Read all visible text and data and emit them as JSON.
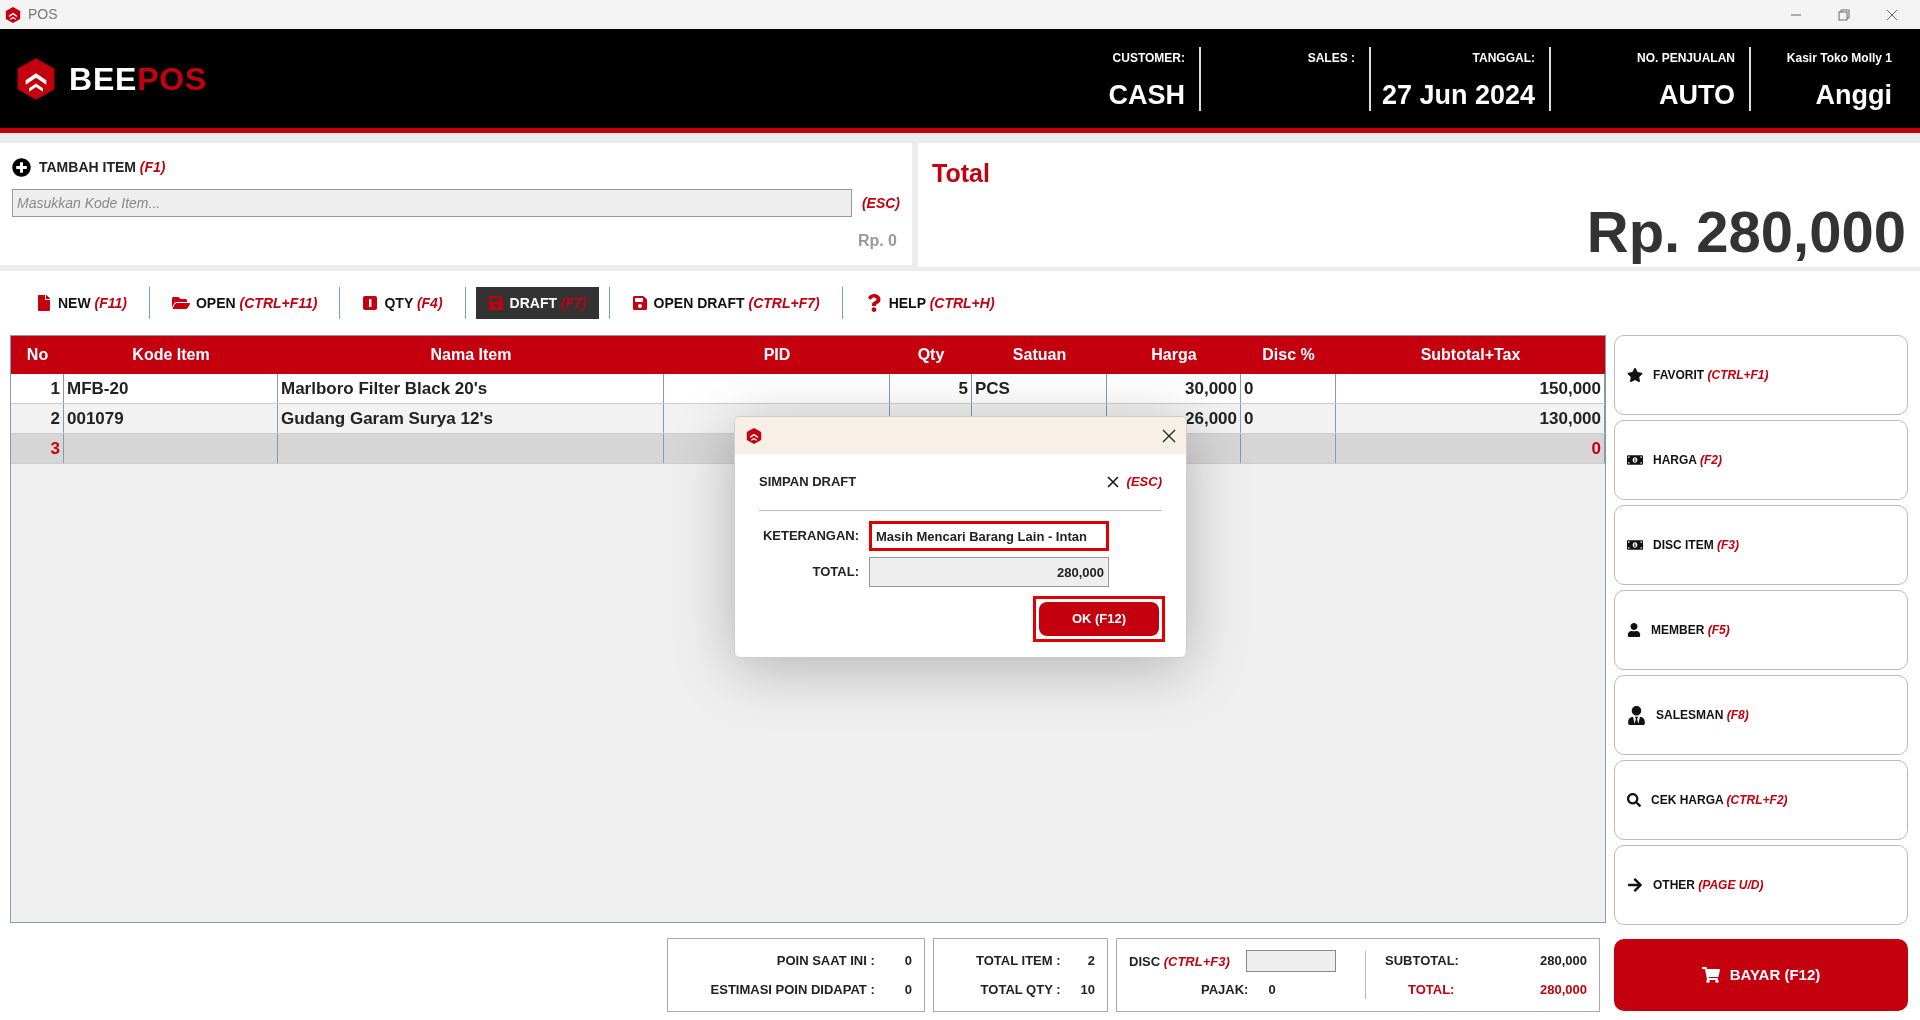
{
  "window": {
    "title": "POS"
  },
  "logo": {
    "first": "BEE",
    "second": "POS"
  },
  "header_fields": [
    {
      "label": "CUSTOMER:",
      "value": "CASH"
    },
    {
      "label": "SALES :"
    },
    {
      "label": "TANGGAL:",
      "value": "27 Jun 2024"
    },
    {
      "label": "NO. PENJUALAN",
      "value": "AUTO"
    },
    {
      "label": "Kasir Toko Molly 1",
      "value": "Anggi"
    }
  ],
  "add_item": {
    "label": "TAMBAH ITEM",
    "shortcut": "(F1)",
    "placeholder": "Masukkan Kode Item...",
    "esc": "(ESC)",
    "price": "Rp. 0"
  },
  "total_panel": {
    "title": "Total",
    "value": "Rp. 280,000"
  },
  "toolbar": [
    {
      "kind": "new",
      "label": "NEW",
      "shortcut": "(F11)",
      "selected": false
    },
    {
      "kind": "open",
      "label": "OPEN",
      "shortcut": "(CTRL+F11)",
      "selected": false
    },
    {
      "kind": "qty",
      "label": "QTY",
      "shortcut": "(F4)",
      "selected": false
    },
    {
      "kind": "draft",
      "label": "DRAFT",
      "shortcut": "(F7)",
      "selected": true
    },
    {
      "kind": "opendraft",
      "label": "OPEN DRAFT",
      "shortcut": "(CTRL+F7)",
      "selected": false
    },
    {
      "kind": "help",
      "label": "HELP",
      "shortcut": "(CTRL+H)",
      "selected": false
    }
  ],
  "table": {
    "columns": [
      "No",
      "Kode Item",
      "Nama Item",
      "PID",
      "Qty",
      "Satuan",
      "Harga",
      "Disc %",
      "Subtotal+Tax"
    ],
    "rows": [
      {
        "cells": [
          "1",
          "MFB-20",
          "Marlboro Filter Black 20's",
          "",
          "5",
          "PCS",
          "30,000",
          "0",
          "150,000"
        ],
        "selected": false
      },
      {
        "cells": [
          "2",
          "001079",
          "Gudang Garam Surya 12's",
          "",
          "",
          "",
          "26,000",
          "0",
          "130,000"
        ],
        "selected": false
      },
      {
        "cells": [
          "3",
          "",
          "",
          "",
          "",
          "",
          "",
          "",
          "0"
        ],
        "selected": true
      }
    ]
  },
  "side_buttons": [
    {
      "kind": "star",
      "label": "FAVORIT",
      "shortcut": "(CTRL+F1)"
    },
    {
      "kind": "money",
      "label": "HARGA",
      "shortcut": "(F2)"
    },
    {
      "kind": "money",
      "label": "DISC ITEM",
      "shortcut": "(F3)"
    },
    {
      "kind": "user",
      "label": "MEMBER",
      "shortcut": "(F5)"
    },
    {
      "kind": "usertie",
      "label": "SALESMAN",
      "shortcut": "(F8)"
    },
    {
      "kind": "search",
      "label": "CEK HARGA",
      "shortcut": "(CTRL+F2)"
    },
    {
      "kind": "arrow",
      "label": "OTHER",
      "shortcut": "(PAGE U/D)"
    }
  ],
  "footer": {
    "points": [
      {
        "label": "POIN SAAT INI :",
        "value": "0"
      },
      {
        "label": "ESTIMASI POIN DIDAPAT :",
        "value": "0"
      }
    ],
    "totals": [
      {
        "label": "TOTAL ITEM :",
        "value": "2"
      },
      {
        "label": "TOTAL QTY :",
        "value": "10"
      }
    ],
    "disc": {
      "label": "DISC",
      "shortcut": "(CTRL+F3)"
    },
    "tax": {
      "label": "PAJAK:",
      "value": "0"
    },
    "subtotal": {
      "label": "SUBTOTAL:",
      "value": "280,000"
    },
    "total": {
      "label": "TOTAL:",
      "value": "280,000"
    },
    "pay_button": "BAYAR (F12)"
  },
  "dialog": {
    "heading": "SIMPAN DRAFT",
    "esc": "(ESC)",
    "fields": [
      {
        "label": "KETERANGAN:",
        "value": "Masih Mencari Barang Lain - Intan",
        "highlighted": true,
        "readonly": false
      },
      {
        "label": "TOTAL:",
        "value": "280,000",
        "highlighted": false,
        "readonly": true
      }
    ],
    "ok_button": {
      "label": "OK (F12)",
      "highlighted": true
    }
  }
}
